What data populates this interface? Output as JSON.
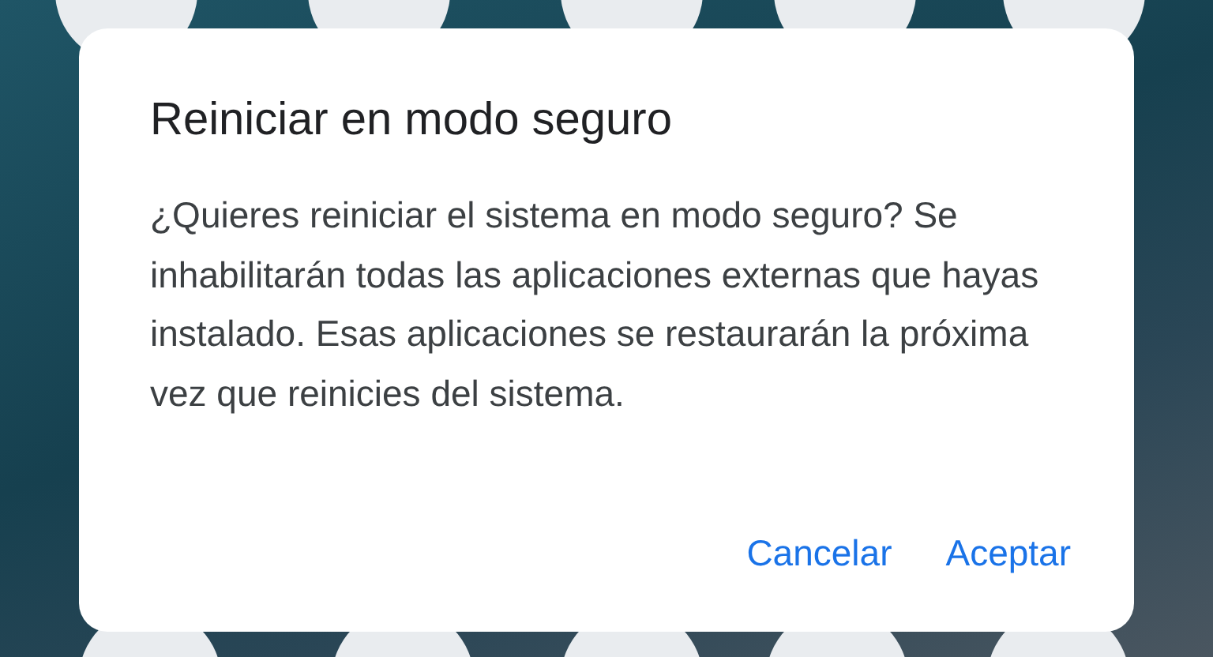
{
  "dialog": {
    "title": "Reiniciar en modo seguro",
    "message": "¿Quieres reiniciar el sistema en modo seguro? Se inhabilitarán todas las aplicaciones externas que hayas instalado. Esas aplicaciones se restaurarán la próxima vez que reinicies del sistema.",
    "buttons": [
      {
        "label": "Cancelar"
      },
      {
        "label": "Aceptar"
      }
    ]
  }
}
